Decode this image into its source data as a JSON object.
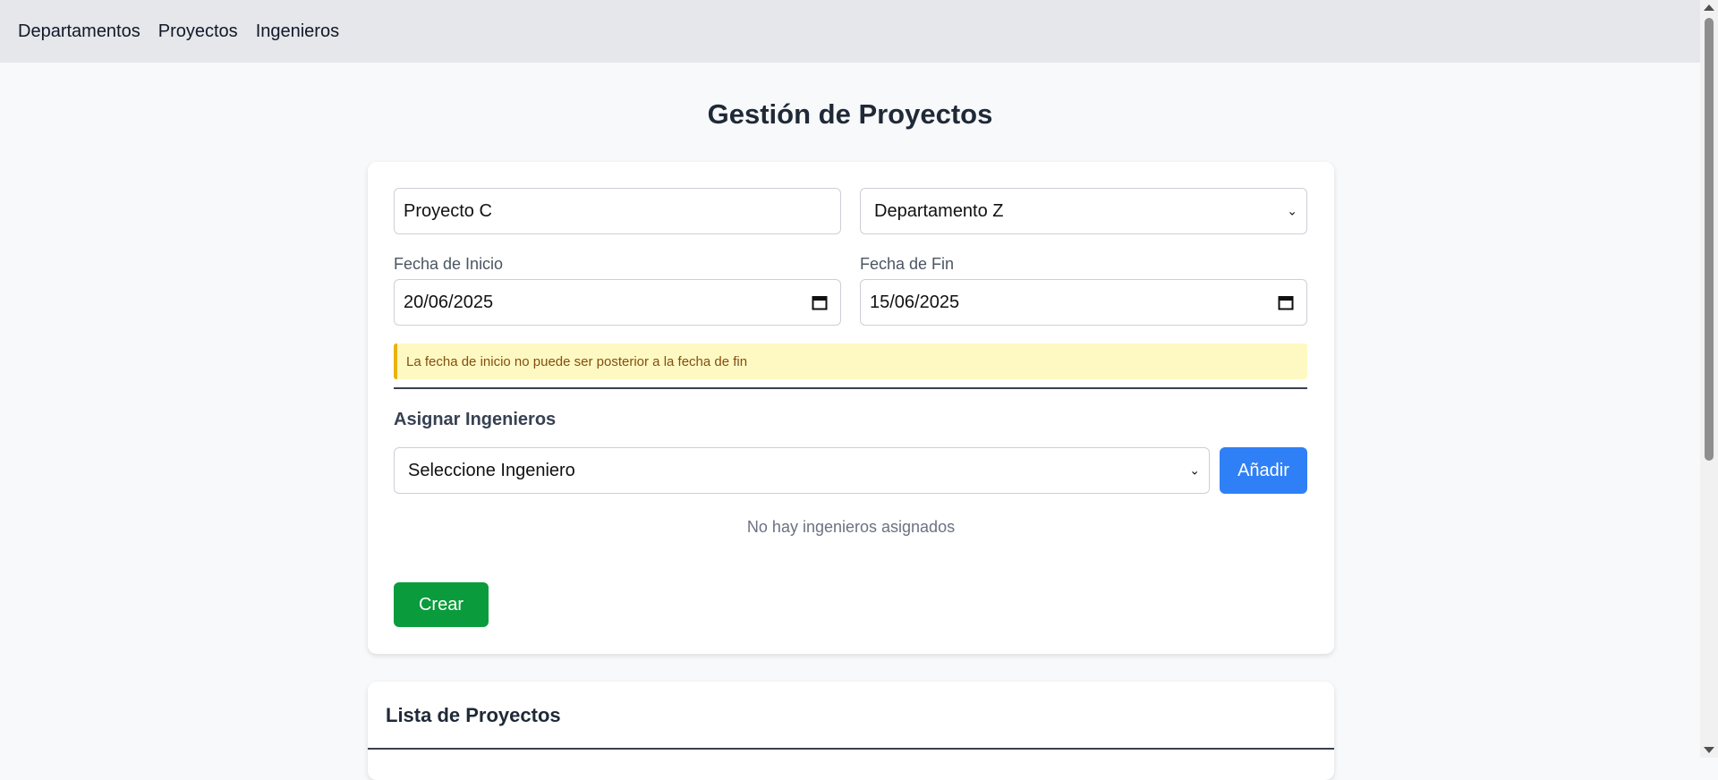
{
  "nav": {
    "items": [
      "Departamentos",
      "Proyectos",
      "Ingenieros"
    ]
  },
  "page": {
    "title": "Gestión de Proyectos"
  },
  "form": {
    "project_name": "Proyecto C",
    "department_selected": "Departamento Z",
    "start_label": "Fecha de Inicio",
    "start_value": "20/06/2025",
    "end_label": "Fecha de Fin",
    "end_value": "15/06/2025",
    "warning": "La fecha de inicio no puede ser posterior a la fecha de fin",
    "assign_title": "Asignar Ingenieros",
    "engineer_select": "Seleccione Ingeniero",
    "add_button": "Añadir",
    "empty_message": "No hay ingenieros asignados",
    "create_button": "Crear"
  },
  "list": {
    "title": "Lista de Proyectos"
  },
  "icons": {
    "calendar": "calendar-icon",
    "chevron": "chevron-down-icon"
  },
  "colors": {
    "primary": "#2f80f6",
    "success": "#0a9c3c",
    "warning_bg": "#fef9c3",
    "warning_border": "#eab308"
  }
}
